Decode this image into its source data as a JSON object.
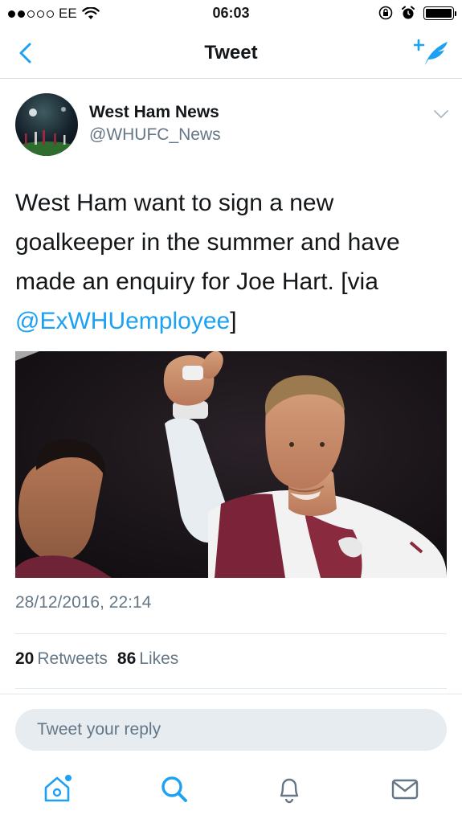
{
  "status_bar": {
    "carrier": "EE",
    "time": "06:03",
    "signal_dots_filled": 2,
    "signal_dots_total": 5,
    "battery_level": 1.0,
    "icons": [
      "wifi-icon",
      "orientation-lock-icon",
      "alarm-icon",
      "battery-icon"
    ]
  },
  "nav": {
    "title": "Tweet",
    "back_icon": "chevron-left-icon",
    "compose_icon": "compose-tweet-icon"
  },
  "tweet": {
    "author_name": "West Ham News",
    "author_handle": "@WHUFC_News",
    "text_line1": "West Ham want to sign a new",
    "text_line2": "goalkeeper in the summer and have",
    "text_line3_prefix": "made an enquiry for Joe Hart. [via",
    "mention": "@ExWHUemployee",
    "text_suffix": "]",
    "timestamp": "28/12/2016, 22:14",
    "retweets_count": "20",
    "retweets_label": "Retweets",
    "likes_count": "86",
    "likes_label": "Likes"
  },
  "reply": {
    "placeholder": "Tweet your reply"
  },
  "tabbar": {
    "items": [
      "home-icon",
      "search-icon",
      "notifications-icon",
      "messages-icon"
    ],
    "home_has_notification_dot": true
  },
  "colors": {
    "accent": "#1da1f2",
    "secondary_text": "#657786",
    "reply_bg": "#e6ecf0"
  }
}
